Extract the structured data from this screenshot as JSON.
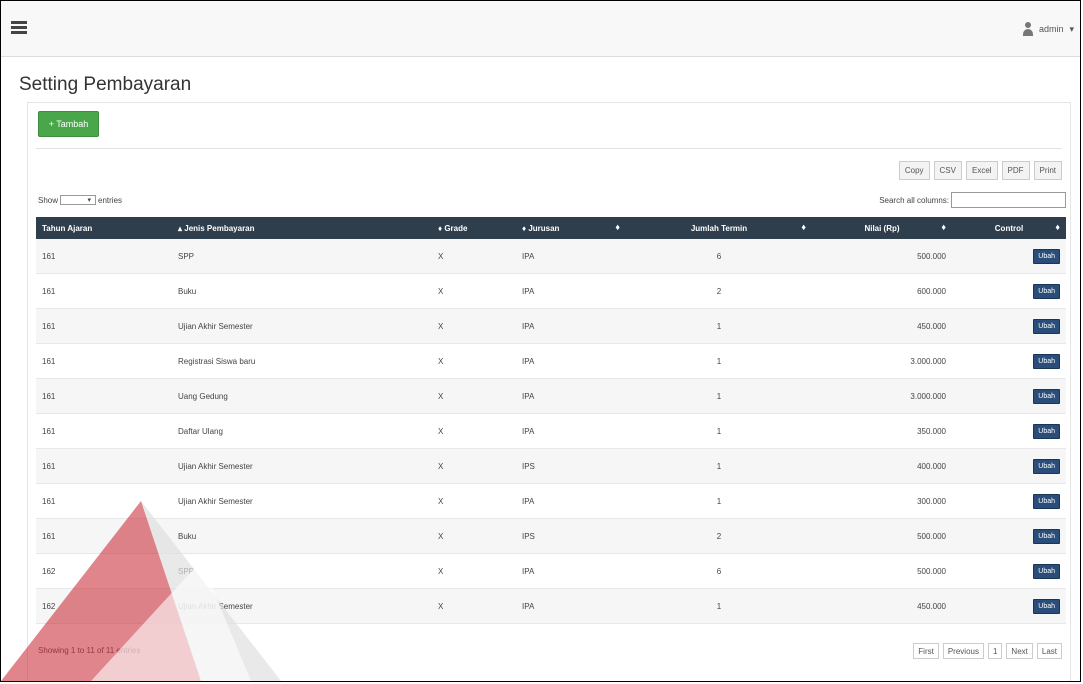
{
  "header": {
    "user_name": "admin"
  },
  "page": {
    "title": "Setting Pembayaran"
  },
  "actions": {
    "add_label": "+ Tambah"
  },
  "export_buttons": [
    "Copy",
    "CSV",
    "Excel",
    "PDF",
    "Print"
  ],
  "table_controls": {
    "show_prefix": "Show",
    "show_suffix": "entries",
    "search_label": "Search all columns:"
  },
  "table": {
    "columns": [
      "Tahun Ajaran",
      "Jenis Pembayaran",
      "Grade",
      "Jurusan",
      "Jumlah Termin",
      "Nilai (Rp)",
      "Control"
    ],
    "action_label": "Ubah",
    "rows": [
      [
        "161",
        "SPP",
        "X",
        "IPA",
        "6",
        "500.000"
      ],
      [
        "161",
        "Buku",
        "X",
        "IPA",
        "2",
        "600.000"
      ],
      [
        "161",
        "Ujian Akhir Semester",
        "X",
        "IPA",
        "1",
        "450.000"
      ],
      [
        "161",
        "Registrasi Siswa baru",
        "X",
        "IPA",
        "1",
        "3.000.000"
      ],
      [
        "161",
        "Uang Gedung",
        "X",
        "IPA",
        "1",
        "3.000.000"
      ],
      [
        "161",
        "Daftar Ulang",
        "X",
        "IPA",
        "1",
        "350.000"
      ],
      [
        "161",
        "Ujian Akhir Semester",
        "X",
        "IPS",
        "1",
        "400.000"
      ],
      [
        "161",
        "Ujian Akhir Semester",
        "X",
        "IPA",
        "1",
        "300.000"
      ],
      [
        "161",
        "Buku",
        "X",
        "IPS",
        "2",
        "500.000"
      ],
      [
        "162",
        "SPP",
        "X",
        "IPA",
        "6",
        "500.000"
      ],
      [
        "162",
        "Ujian Akhir Semester",
        "X",
        "IPA",
        "1",
        "450.000"
      ]
    ]
  },
  "footer": {
    "info": "Showing 1 to 11 of 11 entries",
    "pagination": [
      "First",
      "Previous",
      "1",
      "Next",
      "Last"
    ]
  }
}
